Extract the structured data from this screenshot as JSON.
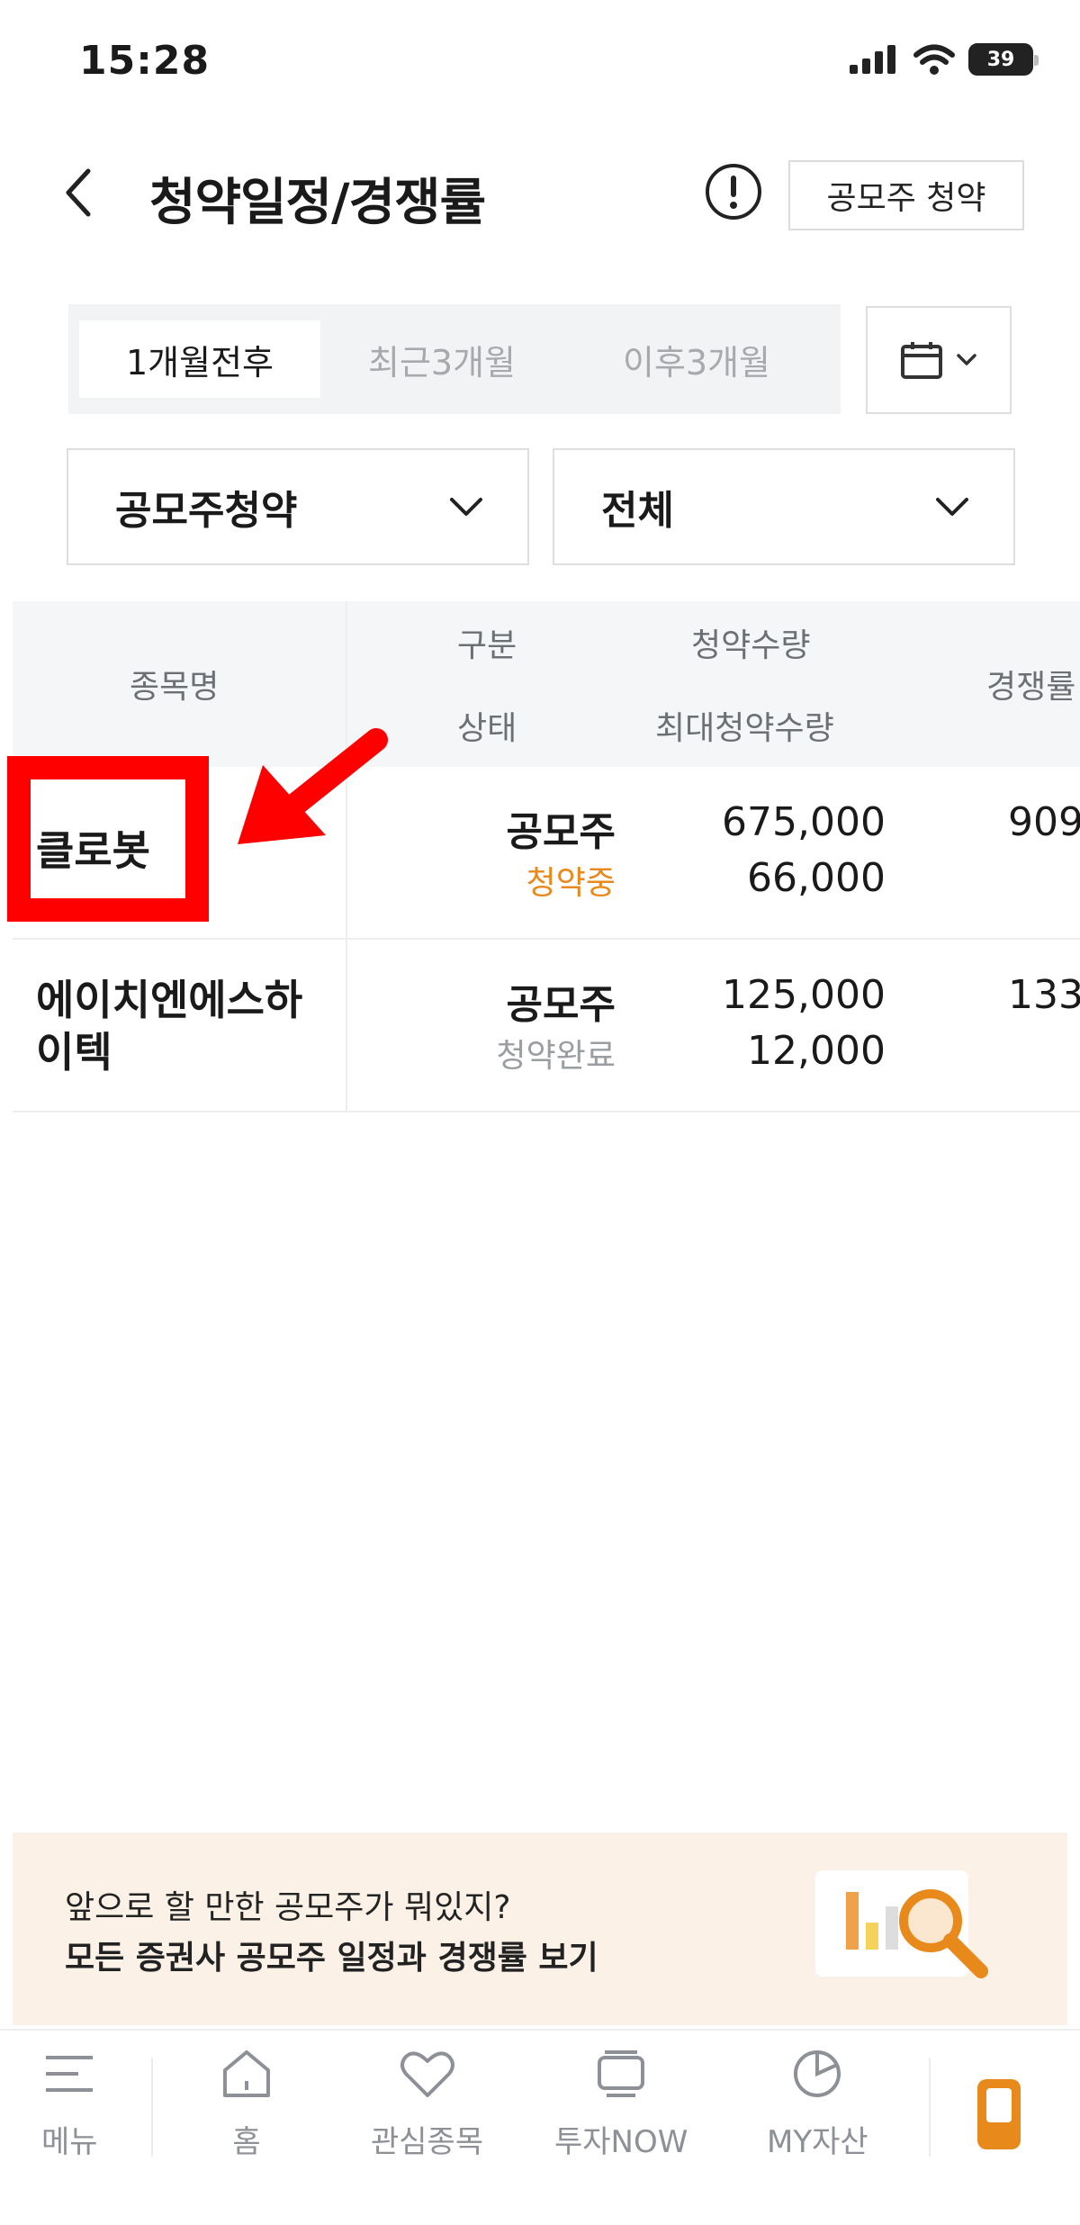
{
  "status_bar": {
    "time": "15:28",
    "battery": "39"
  },
  "header": {
    "title": "청약일정/경쟁률",
    "action_button": "공모주 청약"
  },
  "period_tabs": [
    {
      "label": "1개월전후",
      "active": true
    },
    {
      "label": "최근3개월",
      "active": false
    },
    {
      "label": "이후3개월",
      "active": false
    }
  ],
  "filters": {
    "type_select": "공모주청약",
    "status_select": "전체"
  },
  "table": {
    "headers": {
      "name": "종목명",
      "type": "구분",
      "status": "상태",
      "qty": "청약수량",
      "max_qty": "최대청약수량",
      "rate": "경쟁률"
    },
    "rows": [
      {
        "name": "클로봇",
        "type": "공모주",
        "status": "청약중",
        "qty": "675,000",
        "max_qty": "66,000",
        "rate": "909"
      },
      {
        "name_line1": "에이치엔에스하",
        "name_line2": "이텍",
        "type": "공모주",
        "status": "청약완료",
        "qty": "125,000",
        "max_qty": "12,000",
        "rate": "133"
      }
    ]
  },
  "banner": {
    "line1": "앞으로 할 만한 공모주가 뭐있지?",
    "line2": "모든 증권사 공모주 일정과 경쟁률 보기"
  },
  "bottom_nav": [
    {
      "label": "메뉴",
      "icon": "menu-icon"
    },
    {
      "label": "홈",
      "icon": "home-icon"
    },
    {
      "label": "관심종목",
      "icon": "heart-icon"
    },
    {
      "label": "투자NOW",
      "icon": "tv-icon"
    },
    {
      "label": "MY자산",
      "icon": "pie-chart-icon"
    },
    {
      "label": "",
      "icon": "phone-icon"
    }
  ],
  "colors": {
    "accent_orange": "#e8891c",
    "status_active": "#e8891c",
    "status_done": "#9a9da2",
    "highlight_red": "#ff0000",
    "banner_bg": "#fbf1e6"
  }
}
